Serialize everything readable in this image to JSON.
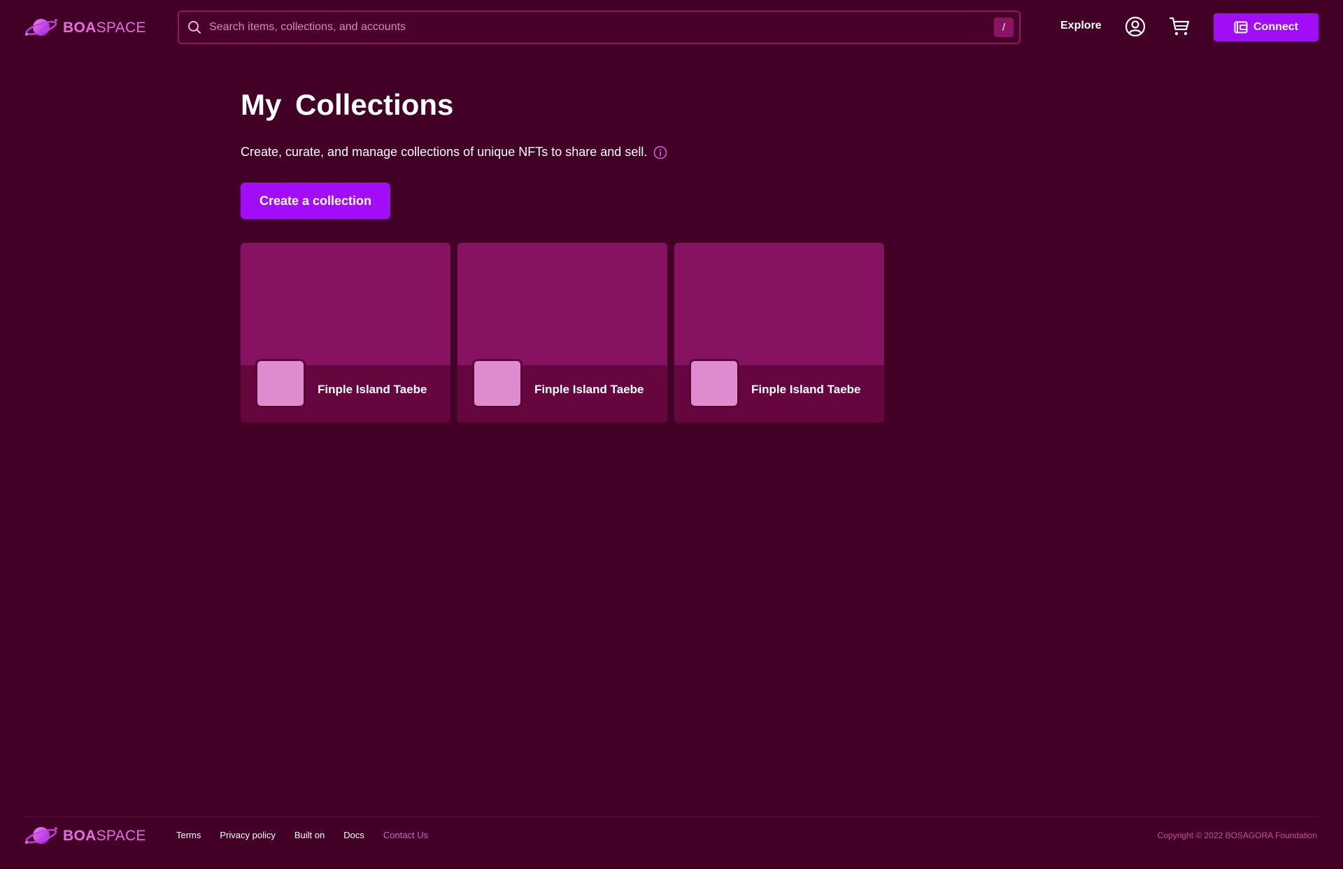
{
  "brand": {
    "name_bold": "BOA",
    "name_light": "SPACE"
  },
  "search": {
    "placeholder": "Search items, collections, and accounts",
    "shortcut_key": "/"
  },
  "nav": {
    "explore_label": "Explore",
    "connect_label": "Connect"
  },
  "main": {
    "title": "My Collections",
    "description": "Create, curate, and manage collections of unique NFTs to share and sell.",
    "create_button_label": "Create a collection",
    "collections": [
      {
        "name": "Finple Island Taebe"
      },
      {
        "name": "Finple Island Taebe"
      },
      {
        "name": "Finple Island Taebe"
      }
    ]
  },
  "footer": {
    "links": [
      {
        "label": "Terms"
      },
      {
        "label": "Privacy policy"
      },
      {
        "label": "Built on"
      },
      {
        "label": "Docs"
      },
      {
        "label": "Contact Us"
      }
    ],
    "copyright": "Copyright © 2022 BOSAGORA Foundation"
  },
  "colors": {
    "background": "#420027",
    "accent": "#a10df7",
    "card_banner": "#871262",
    "card_body": "#66063f",
    "brand_pink": "#e36ee0"
  }
}
